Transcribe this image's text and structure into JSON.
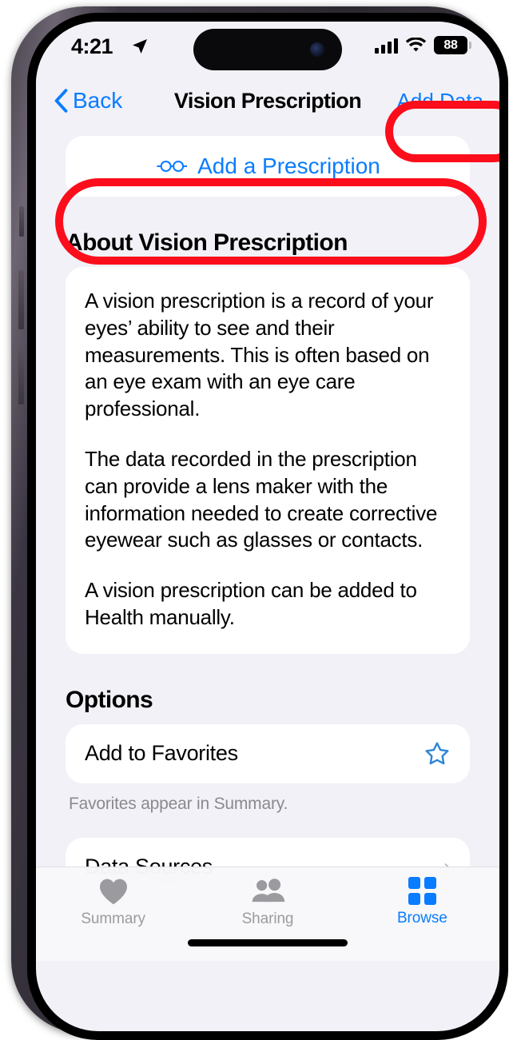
{
  "status_bar": {
    "time": "4:21",
    "location_icon": "location-arrow-icon",
    "cellular_icon": "cellular-signal-icon",
    "wifi_icon": "wifi-icon",
    "battery_level": "88",
    "battery_icon": "battery-icon"
  },
  "nav_bar": {
    "back_label": "Back",
    "back_icon": "chevron-left-icon",
    "title": "Vision Prescription",
    "action_label": "Add Data"
  },
  "primary_action": {
    "label": "Add a Prescription",
    "icon": "eyeglasses-icon"
  },
  "about": {
    "heading": "About Vision Prescription",
    "paragraphs": [
      "A vision prescription is a record of your eyes’ ability to see and their measurements. This is often based on an eye exam with an eye care professional.",
      "The data recorded in the prescription can provide a lens maker with the information needed to create corrective eyewear such as glasses or contacts.",
      "A vision prescription can be added to Health manually."
    ]
  },
  "options": {
    "heading": "Options",
    "favorites_label": "Add to Favorites",
    "favorites_icon": "star-outline-icon",
    "favorites_footnote": "Favorites appear in Summary.",
    "data_sources_label": "Data Sources",
    "data_sources_icon": "chevron-right-icon"
  },
  "tab_bar": {
    "tabs": [
      {
        "label": "Summary",
        "icon": "heart-icon",
        "active": false
      },
      {
        "label": "Sharing",
        "icon": "people-icon",
        "active": false
      },
      {
        "label": "Browse",
        "icon": "grid-icon",
        "active": true
      }
    ]
  },
  "colors": {
    "accent_blue": "#0a7cff",
    "annotation_red": "#fc0d1b",
    "background": "#f2f1f7",
    "card": "#ffffff",
    "inactive_gray": "#9b9b9f"
  }
}
